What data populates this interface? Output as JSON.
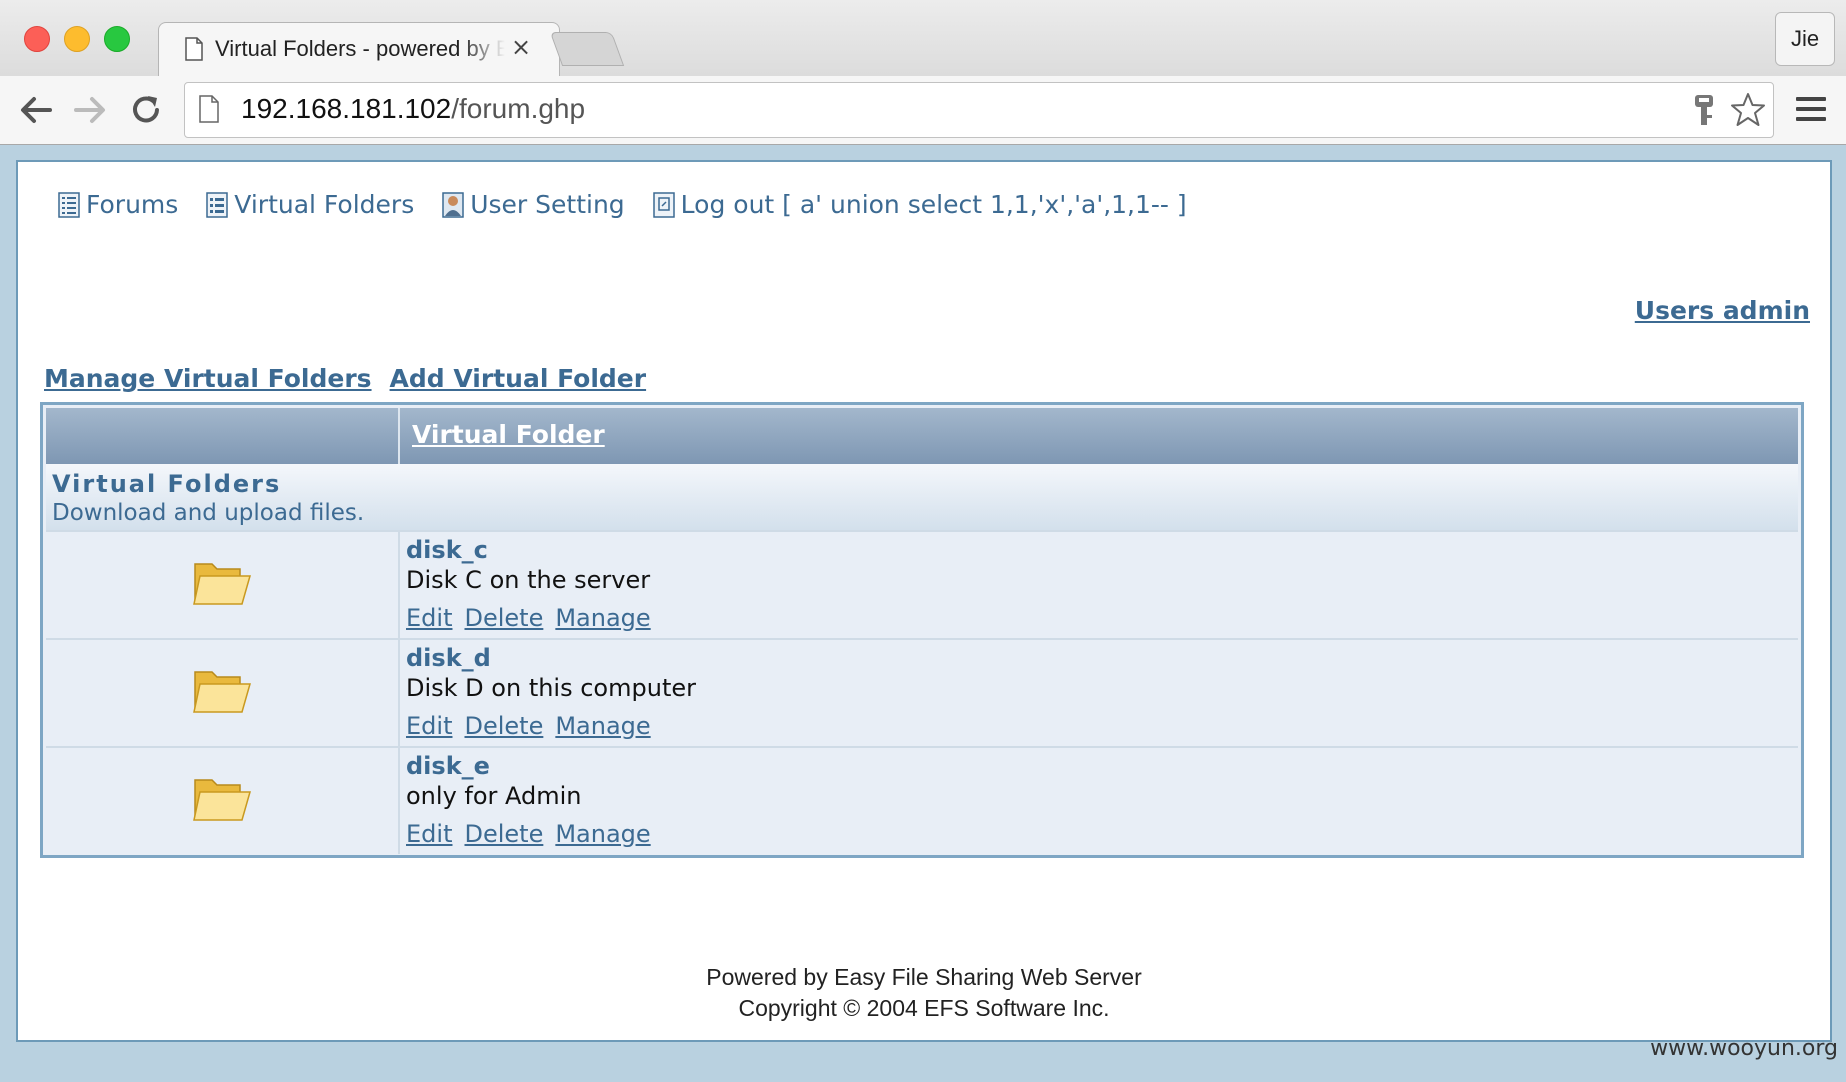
{
  "browser": {
    "tab_title": "Virtual Folders - powered by Easy File Sharing Web Server",
    "tab_close": "×",
    "profile_name": "Jie",
    "url_host": "192.168.181.102",
    "url_path": "/forum.ghp"
  },
  "nav": {
    "items": [
      {
        "label": "Forums",
        "icon": "list-icon"
      },
      {
        "label": "Virtual Folders",
        "icon": "list-icon"
      },
      {
        "label": "User Setting",
        "icon": "user-icon"
      },
      {
        "label": "Log out [ a' union select 1,1,'x','a',1,1-- ]",
        "icon": "logout-icon"
      }
    ]
  },
  "users_admin": "Users admin",
  "actions": {
    "manage": "Manage Virtual Folders",
    "add": "Add Virtual Folder"
  },
  "table": {
    "header": "Virtual Folder",
    "category_title": "Virtual Folders",
    "category_desc": "Download and upload files.",
    "rows": [
      {
        "name": "disk_c",
        "desc": "Disk C on the server",
        "edit": "Edit",
        "delete": "Delete",
        "manage": "Manage"
      },
      {
        "name": "disk_d",
        "desc": "Disk D on this computer",
        "edit": "Edit",
        "delete": "Delete",
        "manage": "Manage"
      },
      {
        "name": "disk_e",
        "desc": "only for Admin",
        "edit": "Edit",
        "delete": "Delete",
        "manage": "Manage"
      }
    ]
  },
  "footer": {
    "line1": "Powered by Easy File Sharing Web Server",
    "line2": "Copyright © 2004 EFS Software Inc."
  },
  "watermark": "www.wooyun.org",
  "colors": {
    "link": "#3c6a92",
    "header_gradient_top": "#a3b7cc",
    "header_gradient_bottom": "#7e97b3",
    "table_border": "#7ea6c4",
    "page_background": "#b9d1e0"
  }
}
